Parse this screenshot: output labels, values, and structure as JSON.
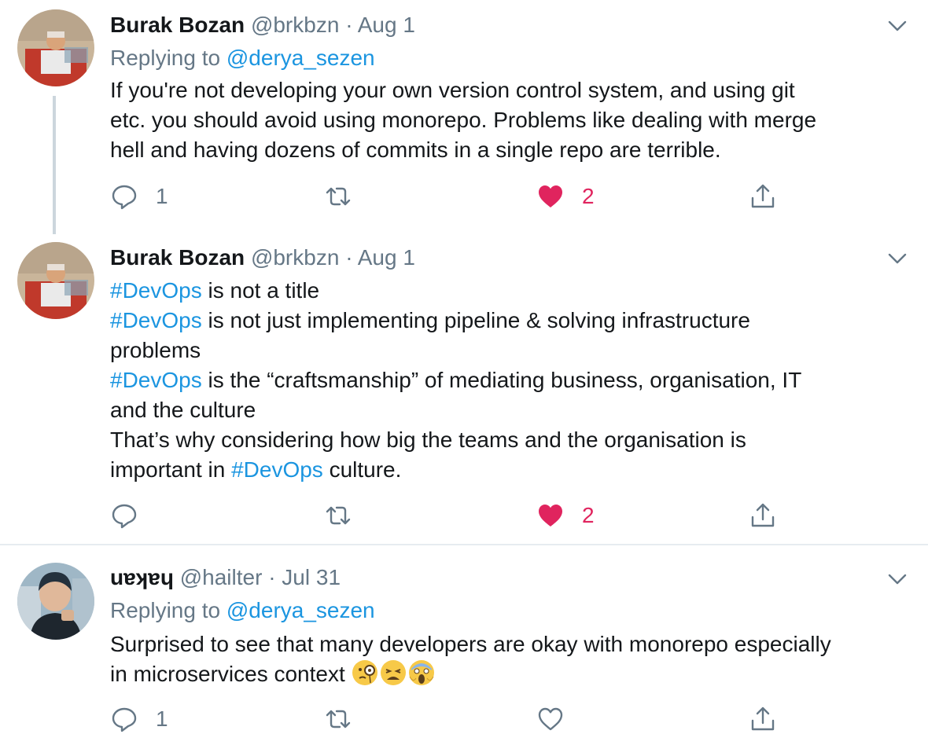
{
  "tweets": [
    {
      "name": "Burak Bozan",
      "handle": "@brkbzn",
      "dot": "·",
      "time": "Aug 1",
      "reply_prefix": "Replying to ",
      "reply_to": "@derya_sezen",
      "lines": [
        "If you're not developing your own version control system, and using git",
        "etc. you should avoid using monorepo. Problems like dealing with merge",
        "hell and having dozens of commits in a single repo are terrible."
      ],
      "reply_count": "1",
      "retweet_count": "",
      "like_count": "2",
      "liked": true
    },
    {
      "name": "Burak Bozan",
      "handle": "@brkbzn",
      "dot": "·",
      "time": "Aug 1",
      "hashtag": "#DevOps",
      "segments": [
        " is not a title",
        " is not just implementing pipeline & solving infrastructure",
        "problems",
        " is the “craftsmanship” of mediating business, organisation, IT",
        "and the culture",
        "That’s why considering how big the teams and the organisation is",
        "important in ",
        " culture."
      ],
      "reply_count": "",
      "retweet_count": "",
      "like_count": "2",
      "liked": true
    },
    {
      "name": "uɐʞɐɥ",
      "handle": "@hailter",
      "dot": "·",
      "time": "Jul 31",
      "reply_prefix": "Replying to ",
      "reply_to": "@derya_sezen",
      "lines": [
        "Surprised to see that many developers are okay with monorepo especially",
        "in microservices context "
      ],
      "emojis": [
        "face-with-monocle-icon",
        "weary-face-icon",
        "face-screaming-icon"
      ],
      "reply_count": "1",
      "retweet_count": "",
      "like_count": "",
      "liked": false
    }
  ],
  "colors": {
    "link": "#1b95e0",
    "like": "#e0245e",
    "muted": "#657786",
    "divider": "#e6ecf0",
    "thread": "#ccd6dd"
  }
}
